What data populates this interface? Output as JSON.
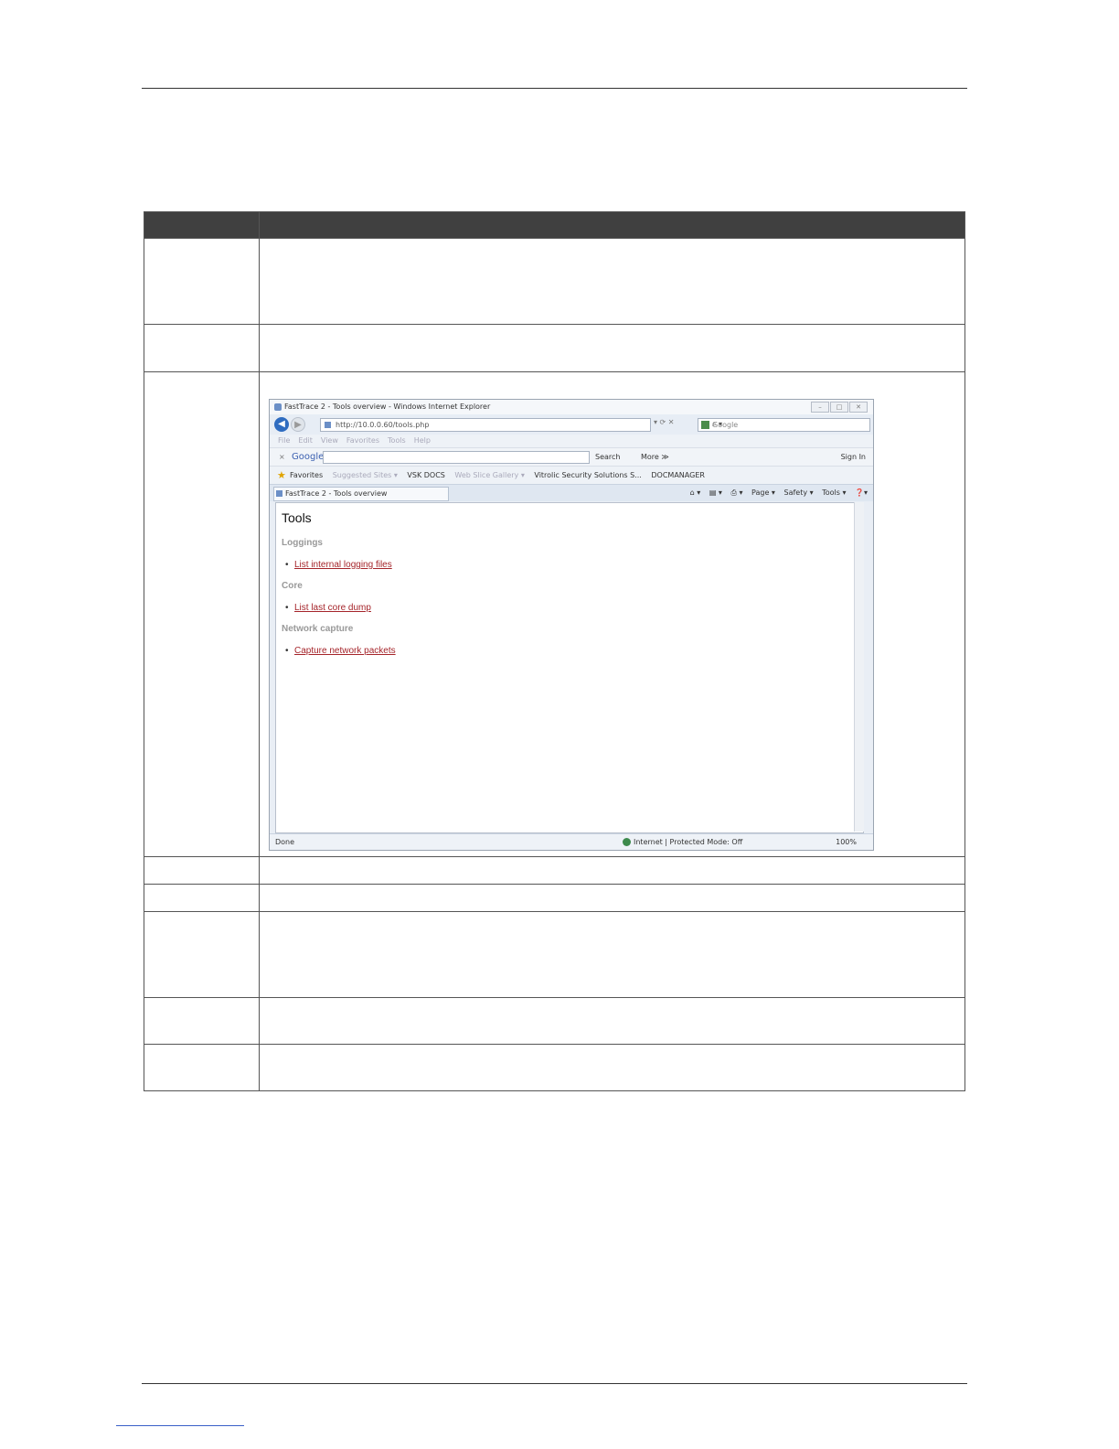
{
  "browser": {
    "window_title": "FastTrace 2 - Tools overview - Windows Internet Explorer",
    "address": "http://10.0.0.60/tools.php",
    "search_placeholder": "Google",
    "menu": [
      "File",
      "Edit",
      "View",
      "Favorites",
      "Tools",
      "Help"
    ],
    "google_bar": {
      "logo": "Google",
      "search_label": "Search",
      "more_label": "More ≫",
      "sign_in_label": "Sign In"
    },
    "favorites": {
      "label": "Favorites",
      "items": [
        "Suggested Sites ▾",
        "VSK DOCS",
        "Web Slice Gallery ▾",
        "Vitrolic Security Solutions S...",
        "DOCMANAGER"
      ]
    },
    "tab_title": "FastTrace 2 - Tools overview",
    "commands": [
      "Page ▾",
      "Safety ▾",
      "Tools ▾"
    ],
    "page": {
      "heading": "Tools",
      "sections": [
        {
          "title": "Loggings",
          "link": "List internal logging files"
        },
        {
          "title": "Core",
          "link": "List last core dump"
        },
        {
          "title": "Network capture",
          "link": "Capture network packets"
        }
      ]
    },
    "status": {
      "left": "Done",
      "zone": "Internet | Protected Mode: Off",
      "zoom": "100%"
    }
  }
}
